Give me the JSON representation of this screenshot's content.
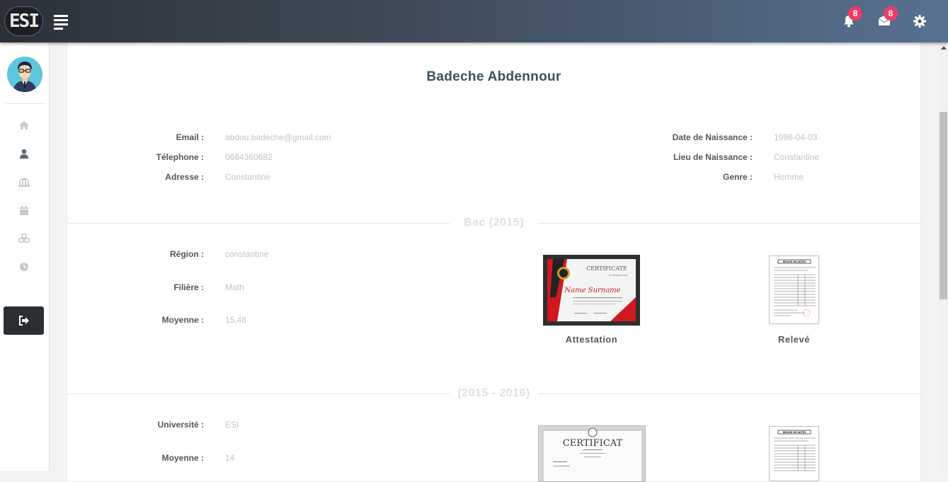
{
  "header": {
    "logo_text": "ESI",
    "notifications_count": "8",
    "messages_count": "8"
  },
  "sidebar": {
    "items": [
      {
        "icon": "home-icon"
      },
      {
        "icon": "user-icon"
      },
      {
        "icon": "university-icon"
      },
      {
        "icon": "calendar-icon"
      },
      {
        "icon": "cubes-icon"
      },
      {
        "icon": "clock-icon"
      }
    ],
    "logout_icon": "sign-out-icon"
  },
  "profile": {
    "name": "Badeche Abdennour",
    "left": [
      {
        "label": "Email :",
        "value": "abdou.badeche@gmail.com"
      },
      {
        "label": "Télephone :",
        "value": "0664360682"
      },
      {
        "label": "Adresse :",
        "value": "Constantine"
      }
    ],
    "right": [
      {
        "label": "Date de Naissance :",
        "value": "1996-04-03"
      },
      {
        "label": "Lieu de Naissance :",
        "value": "Constantine"
      },
      {
        "label": "Genre :",
        "value": "Homme"
      }
    ]
  },
  "bac": {
    "title": "Bac (2015)",
    "fields": [
      {
        "label": "Région :",
        "value": "constantine"
      },
      {
        "label": "Filière :",
        "value": "Math"
      },
      {
        "label": "Moyenne :",
        "value": "15.48"
      }
    ],
    "docs": {
      "attestation": "Attestation",
      "releve": "Relevé",
      "cert_heading": "CERTIFICATE",
      "cert_sub": "OF APPRECIATION",
      "cert_name": "Name Surname",
      "releve_heading": "RELEVE DE NOTES"
    }
  },
  "year1": {
    "title": "(2015 - 2016)",
    "fields": [
      {
        "label": "Université :",
        "value": "ESI"
      },
      {
        "label": "Moyenne :",
        "value": "14"
      }
    ],
    "docs": {
      "cert_heading": "CERTIFICAT",
      "releve_heading": "RELEVE DE NOTES"
    }
  },
  "colors": {
    "topbar_start": "#2c3138",
    "topbar_end": "#587191",
    "badge": "#ef3b6a",
    "accent_red": "#d0191f"
  }
}
